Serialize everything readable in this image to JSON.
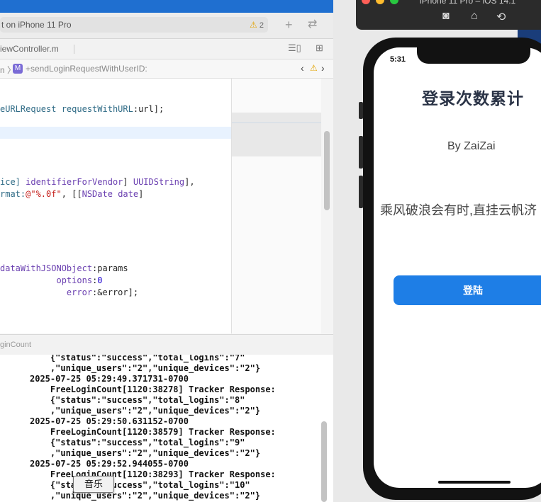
{
  "xcode": {
    "scheme_text": "t on iPhone 11 Pro",
    "warnings_count": "2",
    "tab_file": "iewController.m",
    "jump_left": "n 〉",
    "jump_method_badge": "M",
    "jump_method": "+sendLoginRequestWithUserID:",
    "code_lines": [
      {
        "parts": [
          [
            "teal",
            "eURLRequest "
          ],
          [
            "teal",
            "requestWithURL"
          ],
          [
            "plain",
            ":url];"
          ]
        ]
      },
      {
        "parts": [
          [
            "teal",
            "ice] "
          ],
          [
            "purple",
            "identifierForVendor"
          ],
          [
            "plain",
            "] "
          ],
          [
            "purple",
            "UUIDString"
          ],
          [
            "plain",
            "],"
          ]
        ]
      },
      {
        "parts": [
          [
            "teal",
            "rmat:"
          ],
          [
            "red",
            "@\"%.0f\""
          ],
          [
            "plain",
            ", [["
          ],
          [
            "purple",
            "NSDate"
          ],
          [
            "plain",
            " "
          ],
          [
            "purple",
            "date"
          ],
          [
            "plain",
            "]"
          ]
        ]
      },
      {
        "parts": [
          [
            "purple",
            "dataWithJSONObject"
          ],
          [
            "plain",
            ":params"
          ]
        ]
      },
      {
        "parts": [
          [
            "plain",
            "           "
          ],
          [
            "purple",
            "options"
          ],
          [
            "plain",
            ":"
          ],
          [
            "blue",
            "0"
          ]
        ]
      },
      {
        "parts": [
          [
            "plain",
            "             "
          ],
          [
            "purple",
            "error"
          ],
          [
            "plain",
            ":&error];"
          ]
        ]
      }
    ],
    "debug_label": "ginCount",
    "console_lines": [
      "    {\"status\":\"success\",\"total_logins\":\"7\"",
      "    ,\"unique_users\":\"2\",\"unique_devices\":\"2\"}",
      "2025-07-25 05:29:49.371731-0700",
      "    FreeLoginCount[1120:38278] Tracker Response:",
      "    {\"status\":\"success\",\"total_logins\":\"8\"",
      "    ,\"unique_users\":\"2\",\"unique_devices\":\"2\"}",
      "2025-07-25 05:29:50.631152-0700",
      "    FreeLoginCount[1120:38579] Tracker Response:",
      "    {\"status\":\"success\",\"total_logins\":\"9\"",
      "    ,\"unique_users\":\"2\",\"unique_devices\":\"2\"}",
      "2025-07-25 05:29:52.944055-0700",
      "    FreeLoginCount[1120:38293] Tracker Response:",
      "    {\"status\":\"success\",\"total_logins\":\"10\"",
      "    ,\"unique_users\":\"2\",\"unique_devices\":\"2\"}"
    ],
    "tooltip": "音乐"
  },
  "simulator": {
    "title": "iPhone 11 Pro – iOS 14.1",
    "status_time": "5:31",
    "app_title": "登录次数累计",
    "byline": "By ZaiZai",
    "quote": "乘风破浪会有时,直挂云帆济",
    "login_button": "登陆"
  },
  "colors": {
    "accent": "#1e7ee6",
    "title": "#2a3346"
  }
}
